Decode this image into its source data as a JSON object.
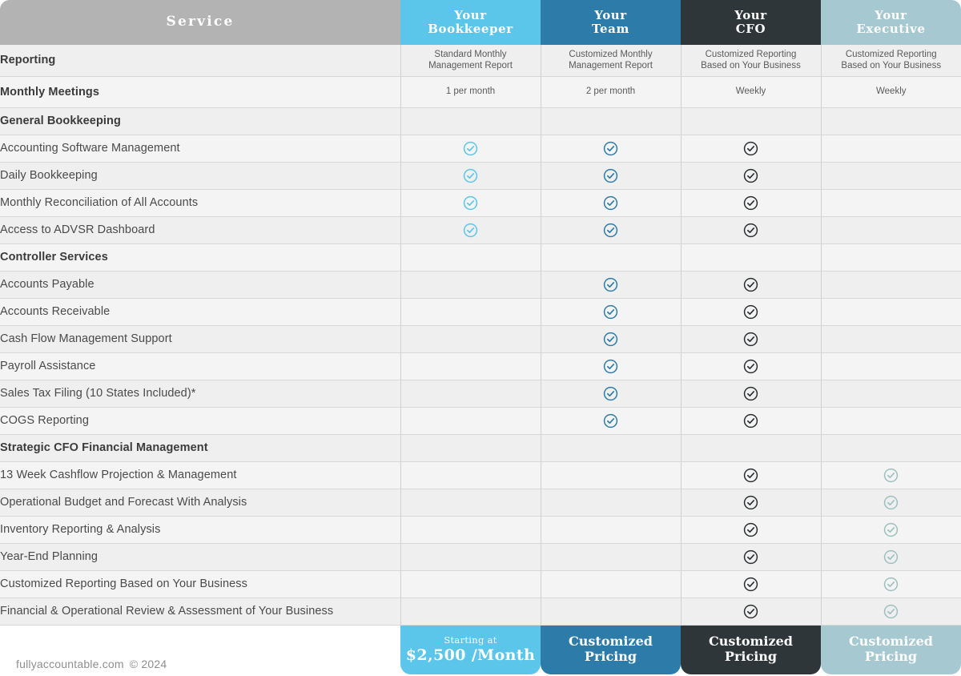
{
  "header": {
    "service_label": "Service",
    "plans": [
      {
        "line1": "Your",
        "line2": "Bookkeeper",
        "color": "#5bc5ea"
      },
      {
        "line1": "Your",
        "line2": "Team",
        "color": "#2d7ba8"
      },
      {
        "line1": "Your",
        "line2": "CFO",
        "color": "#2f3639"
      },
      {
        "line1": "Your",
        "line2": "Executive",
        "color": "#a5c8d1"
      }
    ],
    "service_color": "#b3b3b3"
  },
  "check_colors": {
    "bookkeeper": "#5bc5ea",
    "team": "#2d7ba8",
    "cfo": "#2b2f31",
    "executive": "#9dc0bd"
  },
  "rows": [
    {
      "label": "Reporting",
      "type": "group",
      "cells": [
        "Standard Monthly\nManagement Report",
        "Customized Monthly\nManagement Report",
        "Customized Reporting\nBased on Your Business",
        "Customized Reporting\nBased on Your Business"
      ]
    },
    {
      "label": "Monthly Meetings",
      "type": "group",
      "cells": [
        "1 per month",
        "2 per month",
        "Weekly",
        "Weekly"
      ],
      "small": true
    },
    {
      "label": "General Bookkeeping",
      "type": "group",
      "cells": [
        "",
        "",
        "",
        ""
      ]
    },
    {
      "label": "Accounting Software Management",
      "type": "item",
      "cells": [
        "check",
        "check",
        "check",
        ""
      ]
    },
    {
      "label": "Daily Bookkeeping",
      "type": "item",
      "cells": [
        "check",
        "check",
        "check",
        ""
      ]
    },
    {
      "label": "Monthly Reconciliation of All Accounts",
      "type": "item",
      "cells": [
        "check",
        "check",
        "check",
        ""
      ]
    },
    {
      "label": "Access to ADVSR Dashboard",
      "type": "item",
      "cells": [
        "check",
        "check",
        "check",
        ""
      ]
    },
    {
      "label": "Controller Services",
      "type": "group",
      "cells": [
        "",
        "",
        "",
        ""
      ]
    },
    {
      "label": "Accounts Payable",
      "type": "item",
      "cells": [
        "",
        "check",
        "check",
        ""
      ]
    },
    {
      "label": "Accounts Receivable",
      "type": "item",
      "cells": [
        "",
        "check",
        "check",
        ""
      ]
    },
    {
      "label": "Cash Flow Management Support",
      "type": "item",
      "cells": [
        "",
        "check",
        "check",
        ""
      ]
    },
    {
      "label": "Payroll Assistance",
      "type": "item",
      "cells": [
        "",
        "check",
        "check",
        ""
      ]
    },
    {
      "label": "Sales Tax Filing (10 States Included)*",
      "type": "item",
      "cells": [
        "",
        "check",
        "check",
        ""
      ]
    },
    {
      "label": "COGS Reporting",
      "type": "item",
      "cells": [
        "",
        "check",
        "check",
        ""
      ]
    },
    {
      "label": "Strategic CFO Financial Management",
      "type": "group",
      "cells": [
        "",
        "",
        "",
        ""
      ]
    },
    {
      "label": "13 Week Cashflow Projection & Management",
      "type": "item",
      "cells": [
        "",
        "",
        "check",
        "check"
      ]
    },
    {
      "label": "Operational Budget and Forecast With Analysis",
      "type": "item",
      "cells": [
        "",
        "",
        "check",
        "check"
      ]
    },
    {
      "label": "Inventory Reporting & Analysis",
      "type": "item",
      "cells": [
        "",
        "",
        "check",
        "check"
      ]
    },
    {
      "label": "Year-End Planning",
      "type": "item",
      "cells": [
        "",
        "",
        "check",
        "check"
      ]
    },
    {
      "label": "Customized Reporting Based on Your Business",
      "type": "item",
      "cells": [
        "",
        "",
        "check",
        "check"
      ]
    },
    {
      "label": "Financial & Operational Review & Assessment of Your Business",
      "type": "item",
      "cells": [
        "",
        "",
        "check",
        "check"
      ]
    }
  ],
  "footer": {
    "pricing": [
      {
        "lead": "Starting at",
        "price": "$2,500 /Month",
        "color": "#5bc5ea"
      },
      {
        "line1": "Customized",
        "line2": "Pricing",
        "color": "#2d7ba8"
      },
      {
        "line1": "Customized",
        "line2": "Pricing",
        "color": "#2f3639"
      },
      {
        "line1": "Customized",
        "line2": "Pricing",
        "color": "#a5c8d1"
      }
    ]
  },
  "attribution": {
    "site": "fullyaccountable.com",
    "copyright": "© 2024"
  }
}
